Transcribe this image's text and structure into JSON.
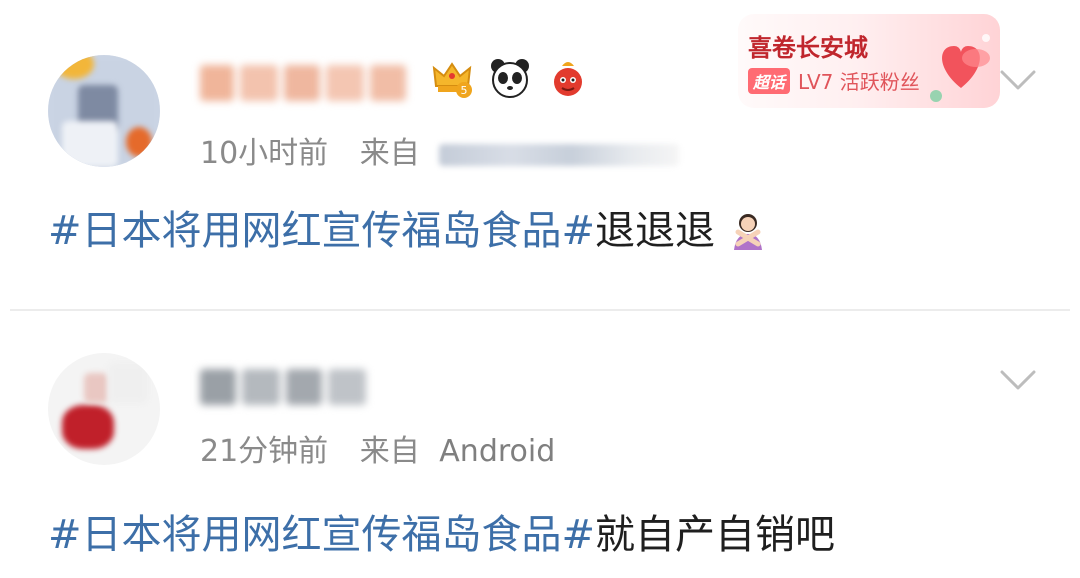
{
  "posts": [
    {
      "time": "10小时前",
      "from_label": "来自",
      "source": "",
      "content": {
        "topic": "#日本将用网红宣传福岛食品#",
        "text": "退退退",
        "emoji": "woman-gesturing-no-emoji"
      },
      "badges": [
        "crown-level-5-icon",
        "panda-icon",
        "red-fruit-mascot-icon"
      ],
      "fan_card": {
        "title": "喜卷长安城",
        "chao_label": "超话",
        "level": "LV7 活跃粉丝"
      },
      "menu_icon": "chevron-down-icon"
    },
    {
      "time": "21分钟前",
      "from_label": "来自",
      "source": "Android",
      "content": {
        "topic": "#日本将用网红宣传福岛食品#",
        "text": "就自产自销吧"
      },
      "menu_icon": "chevron-down-icon"
    }
  ],
  "colors": {
    "topic": "#3d6fa8",
    "meta": "#8a8a8a",
    "text": "#1f1f1f",
    "fan_title": "#c0262d",
    "fan_level": "#e0545a"
  }
}
